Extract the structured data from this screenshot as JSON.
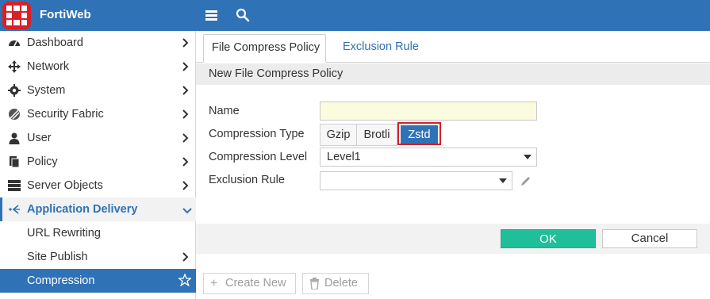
{
  "app": {
    "brand": "FortiWeb",
    "colors": {
      "topbar": "#2f72b6",
      "accent": "#2f72b6",
      "highlight": "#d22129",
      "ok": "#1fbf9a"
    }
  },
  "topbar": {
    "menu_icon": "hamburger-icon",
    "search_icon": "search-icon"
  },
  "sidebar": {
    "items": [
      {
        "label": "Dashboard",
        "icon": "dashboard-icon",
        "has_chevron": true
      },
      {
        "label": "Network",
        "icon": "network-move-icon",
        "has_chevron": true
      },
      {
        "label": "System",
        "icon": "gear-icon",
        "has_chevron": true
      },
      {
        "label": "Security Fabric",
        "icon": "security-fabric-icon",
        "has_chevron": true
      },
      {
        "label": "User",
        "icon": "user-icon",
        "has_chevron": true
      },
      {
        "label": "Policy",
        "icon": "policy-icon",
        "has_chevron": true
      },
      {
        "label": "Server Objects",
        "icon": "server-icon",
        "has_chevron": true
      },
      {
        "label": "Application Delivery",
        "icon": "app-delivery-icon",
        "state": "expanded"
      },
      {
        "label": "URL Rewriting"
      },
      {
        "label": "Site Publish",
        "has_chevron": true
      },
      {
        "label": "Compression",
        "state": "selected",
        "icon": "star-icon"
      }
    ]
  },
  "tabs": [
    {
      "label": "File Compress Policy",
      "active": true
    },
    {
      "label": "Exclusion Rule",
      "active": false
    }
  ],
  "form": {
    "section_title": "New File Compress Policy",
    "name_label": "Name",
    "name_value": "",
    "compression_type_label": "Compression Type",
    "compression_types": [
      "Gzip",
      "Brotli",
      "Zstd"
    ],
    "compression_type_selected": "Zstd",
    "compression_level_label": "Compression Level",
    "compression_level_value": "Level1",
    "exclusion_rule_label": "Exclusion Rule",
    "exclusion_rule_value": ""
  },
  "buttons": {
    "ok": "OK",
    "cancel": "Cancel"
  },
  "toolbar": {
    "create_new": "Create New",
    "delete": "Delete"
  }
}
